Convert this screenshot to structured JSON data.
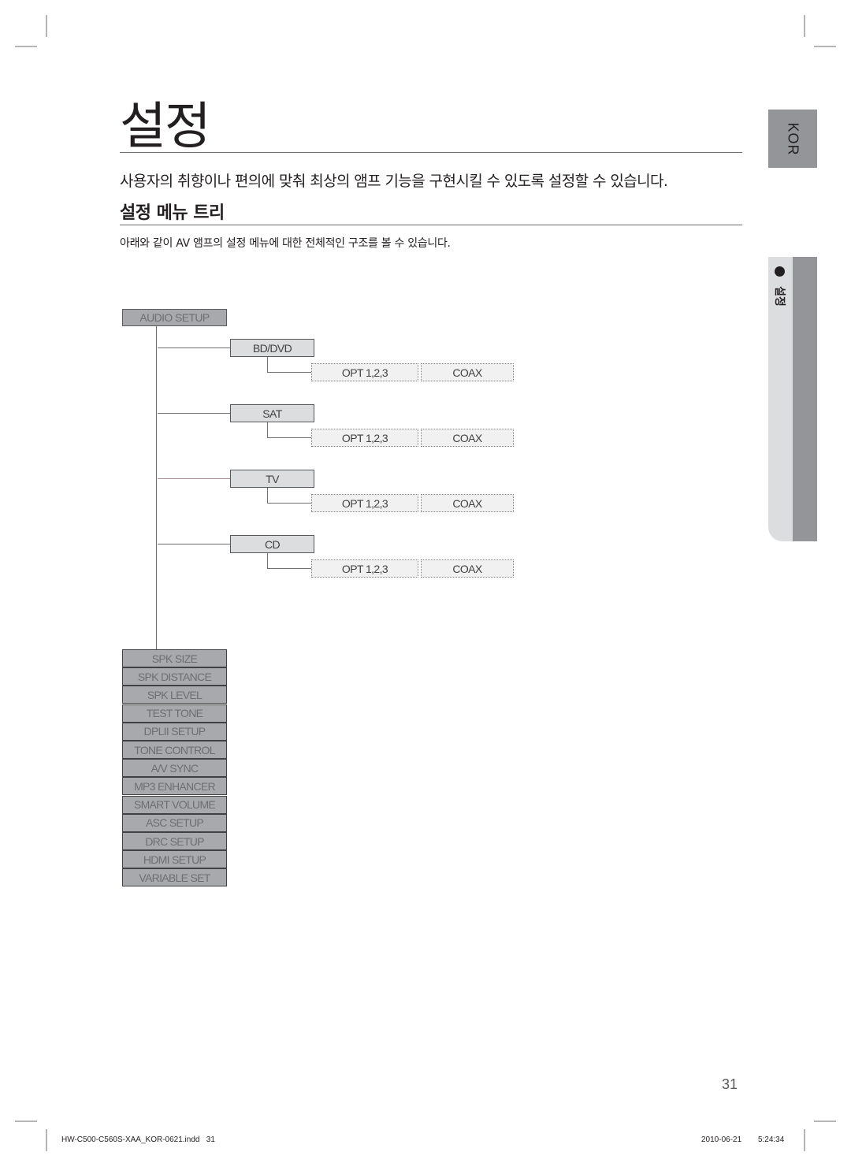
{
  "page": {
    "title": "설정",
    "intro": "사용자의 취향이나 편의에 맞춰 최상의 앰프 기능을 구현시킬 수 있도록 설정할 수 있습니다.",
    "section_title": "설정 메뉴 트리",
    "section_desc": "아래와 같이 AV 앰프의 설정 메뉴에 대한 전체적인 구조를 볼 수 있습니다."
  },
  "side": {
    "language_tab": "KOR",
    "chapter_label": "설정"
  },
  "tree": {
    "root": "AUDIO SETUP",
    "sources": [
      {
        "label": "BD/DVD",
        "options": [
          "OPT 1,2,3",
          "COAX"
        ]
      },
      {
        "label": "SAT",
        "options": [
          "OPT 1,2,3",
          "COAX"
        ]
      },
      {
        "label": "TV",
        "options": [
          "OPT 1,2,3",
          "COAX"
        ]
      },
      {
        "label": "CD",
        "options": [
          "OPT 1,2,3",
          "COAX"
        ]
      }
    ],
    "menu_items": [
      "SPK SIZE",
      "SPK DISTANCE",
      "SPK LEVEL",
      "TEST TONE",
      "DPLII SETUP",
      "TONE CONTROL",
      "A/V SYNC",
      "MP3 ENHANCER",
      "SMART VOLUME",
      "ASC SETUP",
      "DRC SETUP",
      "HDMI SETUP",
      "VARIABLE SET"
    ]
  },
  "footer": {
    "page_number": "31",
    "file_info": "HW-C500-C560S-XAA_KOR-0621.indd   31",
    "date": "2010-06-21",
    "time": "5:24:34"
  }
}
